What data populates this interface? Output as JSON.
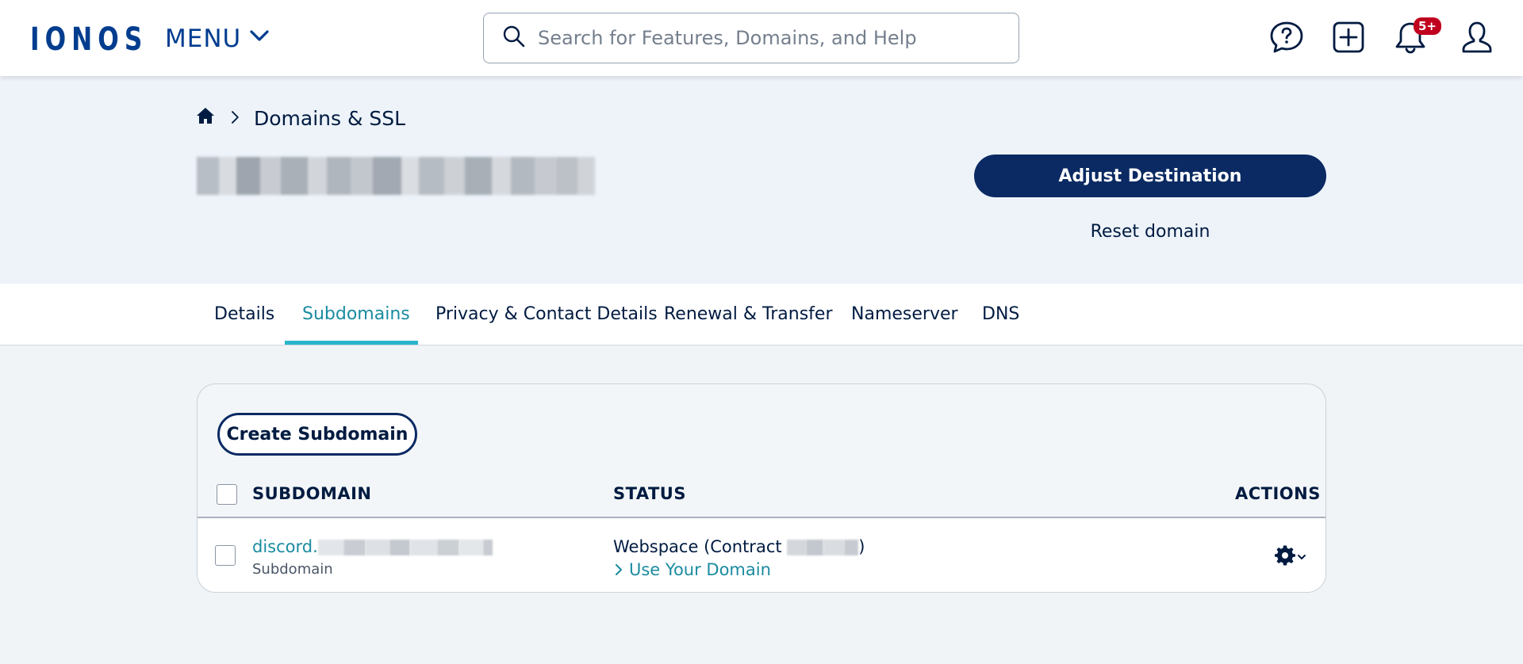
{
  "header": {
    "logo": "IONOS",
    "menu_label": "MENU",
    "search_placeholder": "Search for Features, Domains, and Help",
    "notifications_badge": "5+",
    "icons": [
      "help-chat-icon",
      "add-icon",
      "bell-icon",
      "user-icon"
    ]
  },
  "breadcrumb": {
    "home_icon": "home-icon",
    "current": "Domains & SSL"
  },
  "hero": {
    "adjust_button": "Adjust Destination",
    "reset_link": "Reset domain"
  },
  "tabs": [
    {
      "label": "Details",
      "active": false
    },
    {
      "label": "Subdomains",
      "active": true
    },
    {
      "label": "Privacy & Contact Details",
      "active": false
    },
    {
      "label": "Renewal & Transfer",
      "active": false
    },
    {
      "label": "Nameserver",
      "active": false
    },
    {
      "label": "DNS",
      "active": false
    }
  ],
  "subdomains": {
    "create_button": "Create Subdomain",
    "columns": {
      "subdomain": "SUBDOMAIN",
      "status": "STATUS",
      "actions": "ACTIONS"
    },
    "rows": [
      {
        "name_prefix": "discord.",
        "type": "Subdomain",
        "status_prefix": "Webspace (Contract",
        "status_suffix": ")",
        "link": "Use Your Domain"
      }
    ]
  },
  "colors": {
    "brand": "#003d8f",
    "primary_button": "#0b2a63",
    "accent_teal": "#1a8ba0",
    "tab_underline": "#2bb5cd",
    "badge": "#c0001e"
  }
}
